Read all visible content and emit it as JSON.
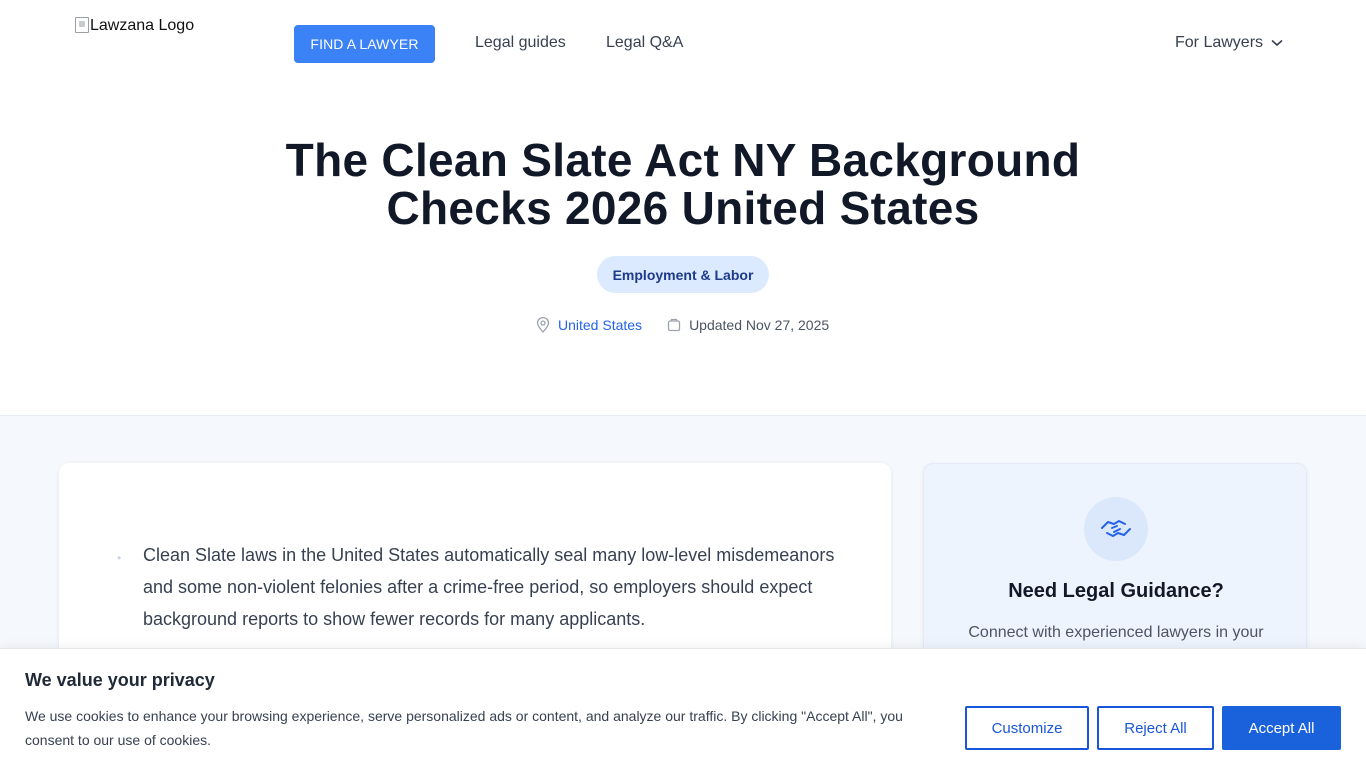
{
  "header": {
    "logo_alt": "Lawzana Logo",
    "find_lawyer_label": "FIND A LAWYER",
    "nav": [
      "Legal guides",
      "Legal Q&A"
    ],
    "for_lawyers_label": "For Lawyers"
  },
  "hero": {
    "title": "The Clean Slate Act NY Background Checks 2026 United States",
    "category": "Employment & Labor",
    "location": "United States",
    "updated": "Updated Nov 27, 2025"
  },
  "article": {
    "bullet_1": "Clean Slate laws in the United States automatically seal many low-level misdemeanors and some non-violent felonies after a crime-free period, so employers should expect background reports to show fewer records for many applicants."
  },
  "sidebar": {
    "title": "Need Legal Guidance?",
    "text": "Connect with experienced lawyers in your"
  },
  "cookie": {
    "title": "We value your privacy",
    "text": "We use cookies to enhance your browsing experience, serve personalized ads or content, and analyze our traffic. By clicking \"Accept All\", you consent to our use of cookies.",
    "customize": "Customize",
    "reject": "Reject All",
    "accept": "Accept All"
  },
  "colors": {
    "primary": "#3b82f6",
    "accept_button": "#1a62db",
    "link": "#2563eb",
    "badge_bg": "#dbeafe",
    "badge_text": "#1e3a8a"
  },
  "icons": [
    "broken-image-icon",
    "chevron-down-icon",
    "location-pin-icon",
    "clock-icon",
    "handshake-icon"
  ]
}
